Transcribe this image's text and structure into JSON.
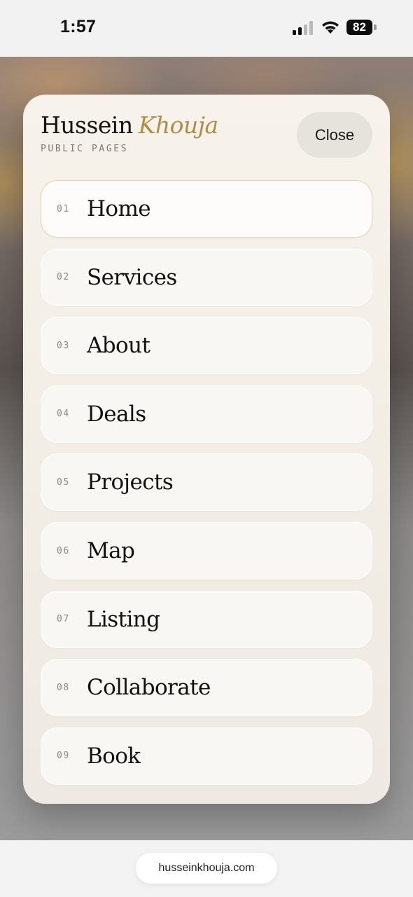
{
  "status_bar": {
    "time": "1:57",
    "battery": "82",
    "icons": [
      "signal-icon",
      "wifi-icon",
      "battery-icon"
    ]
  },
  "menu": {
    "brand_first": "Hussein",
    "brand_last": "Khouja",
    "subtitle": "PUBLIC PAGES",
    "close_label": "Close",
    "active_index": 0,
    "items": [
      {
        "num": "01",
        "label": "Home"
      },
      {
        "num": "02",
        "label": "Services"
      },
      {
        "num": "03",
        "label": "About"
      },
      {
        "num": "04",
        "label": "Deals"
      },
      {
        "num": "05",
        "label": "Projects"
      },
      {
        "num": "06",
        "label": "Map"
      },
      {
        "num": "07",
        "label": "Listing"
      },
      {
        "num": "08",
        "label": "Collaborate"
      },
      {
        "num": "09",
        "label": "Book"
      }
    ]
  },
  "browser": {
    "url": "husseinkhouja.com"
  },
  "colors": {
    "accent_gold": "#b08d45",
    "panel_bg": "#f3efe8",
    "active_border": "#e2d3b4"
  }
}
